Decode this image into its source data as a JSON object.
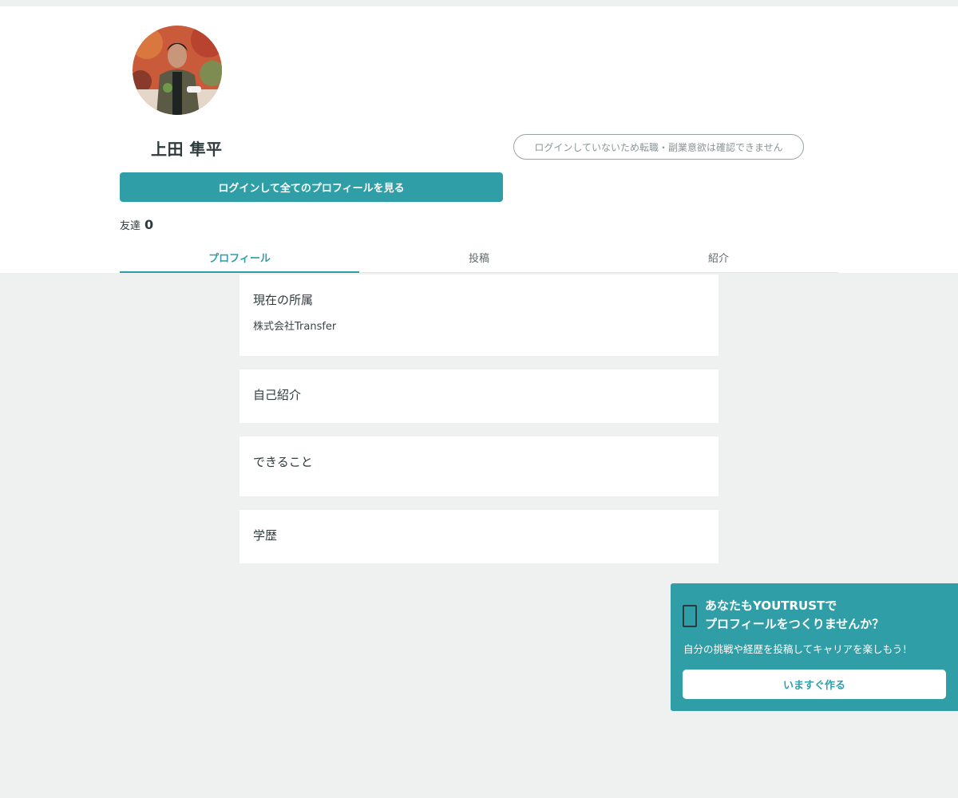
{
  "profile": {
    "name": "上田 隼平",
    "status_notice": "ログインしていないため転職・副業意欲は確認できません",
    "login_button": "ログインして全てのプロフィールを見る",
    "friends_label": "友達",
    "friends_count": "0"
  },
  "tabs": [
    {
      "label": "プロフィール",
      "active": true
    },
    {
      "label": "投稿",
      "active": false
    },
    {
      "label": "紹介",
      "active": false
    }
  ],
  "sections": {
    "affiliation": {
      "title": "現在の所属",
      "value": "株式会社Transfer"
    },
    "intro": {
      "title": "自己紹介"
    },
    "skills": {
      "title": "できること"
    },
    "education": {
      "title": "学歴"
    }
  },
  "cta": {
    "title_line1": "あなたもYOUTRUSTで",
    "title_line2": "プロフィールをつくりませんか？",
    "subtitle": "自分の挑戦や経歴を投稿してキャリアを楽しもう！",
    "button": "いますぐ作る",
    "icon": "phone-icon"
  },
  "colors": {
    "accent": "#309ea7",
    "background": "#eff0f0"
  }
}
